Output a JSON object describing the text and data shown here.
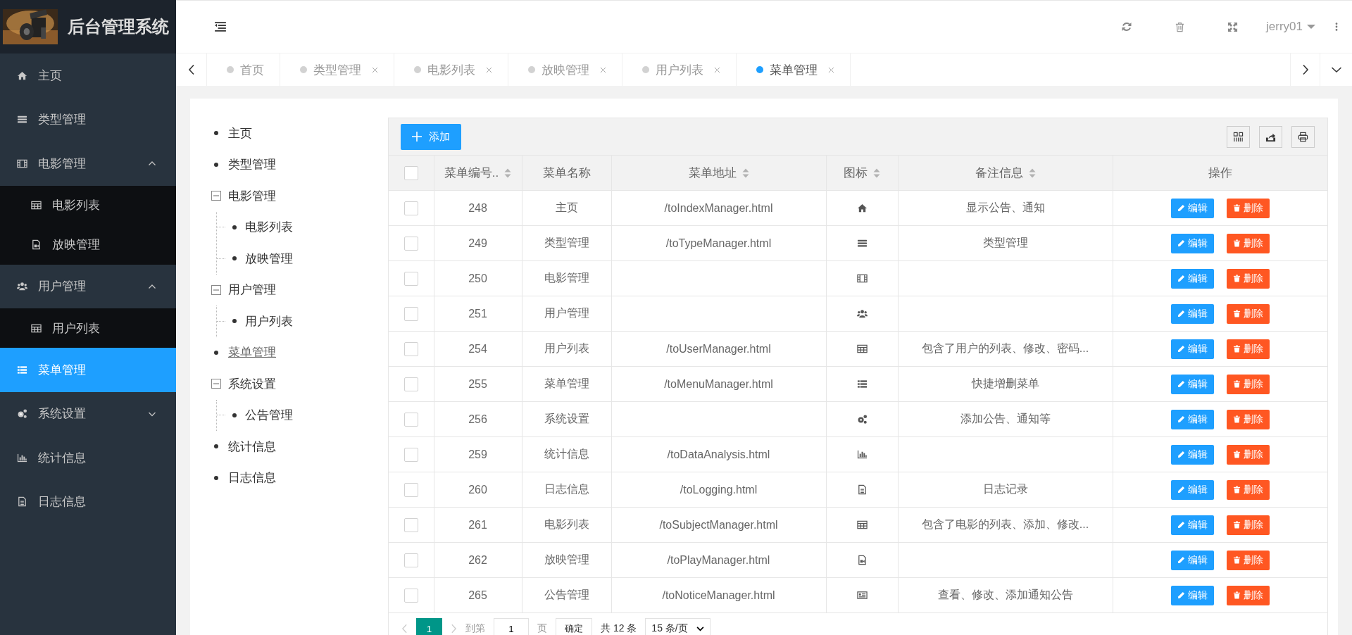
{
  "app": {
    "title": "后台管理系统"
  },
  "sidebar": {
    "items": [
      {
        "label": "主页",
        "selected": false
      },
      {
        "label": "类型管理",
        "selected": false
      },
      {
        "label": "电影管理",
        "selected": false,
        "expanded": true,
        "children": [
          {
            "label": "电影列表",
            "selected": false
          },
          {
            "label": "放映管理",
            "selected": false
          }
        ]
      },
      {
        "label": "用户管理",
        "selected": false,
        "expanded": true,
        "children": [
          {
            "label": "用户列表",
            "selected": false
          }
        ]
      },
      {
        "label": "菜单管理",
        "selected": true
      },
      {
        "label": "系统设置",
        "selected": false,
        "expanded": false
      },
      {
        "label": "统计信息",
        "selected": false
      },
      {
        "label": "日志信息",
        "selected": false
      }
    ]
  },
  "header": {
    "user": "jerry01"
  },
  "tabs": [
    {
      "label": "首页",
      "selected": false,
      "closable": false
    },
    {
      "label": "类型管理",
      "selected": false,
      "closable": true
    },
    {
      "label": "电影列表",
      "selected": false,
      "closable": true
    },
    {
      "label": "放映管理",
      "selected": false,
      "closable": true
    },
    {
      "label": "用户列表",
      "selected": false,
      "closable": true
    },
    {
      "label": "菜单管理",
      "selected": true,
      "closable": true
    }
  ],
  "tree": [
    {
      "label": "主页",
      "selected": false
    },
    {
      "label": "类型管理",
      "selected": false
    },
    {
      "label": "电影管理",
      "selected": false,
      "expanded": true,
      "children": [
        {
          "label": "电影列表",
          "selected": false
        },
        {
          "label": "放映管理",
          "selected": false
        }
      ]
    },
    {
      "label": "用户管理",
      "selected": false,
      "expanded": true,
      "children": [
        {
          "label": "用户列表",
          "selected": false
        }
      ]
    },
    {
      "label": "菜单管理",
      "selected": true
    },
    {
      "label": "系统设置",
      "selected": false,
      "expanded": true,
      "children": [
        {
          "label": "公告管理",
          "selected": false
        }
      ]
    },
    {
      "label": "统计信息",
      "selected": false
    },
    {
      "label": "日志信息",
      "selected": false
    }
  ],
  "table": {
    "add_button": "添加",
    "columns": [
      {
        "label": "菜单编号..",
        "sortable": true
      },
      {
        "label": "菜单名称",
        "sortable": false
      },
      {
        "label": "菜单地址",
        "sortable": true
      },
      {
        "label": "图标",
        "sortable": true
      },
      {
        "label": "备注信息",
        "sortable": true
      },
      {
        "label": "操作",
        "sortable": false
      }
    ],
    "all_checked": false,
    "rows": [
      {
        "id": "248",
        "name": "主页",
        "url": "/toIndexManager.html",
        "remark": "显示公告、通知",
        "checked": false,
        "actions": [
          "编辑",
          "删除"
        ]
      },
      {
        "id": "249",
        "name": "类型管理",
        "url": "/toTypeManager.html",
        "remark": "类型管理",
        "checked": false,
        "actions": [
          "编辑",
          "删除"
        ]
      },
      {
        "id": "250",
        "name": "电影管理",
        "url": "",
        "remark": "",
        "checked": false,
        "actions": [
          "编辑",
          "删除"
        ]
      },
      {
        "id": "251",
        "name": "用户管理",
        "url": "",
        "remark": "",
        "checked": false,
        "actions": [
          "编辑",
          "删除"
        ]
      },
      {
        "id": "254",
        "name": "用户列表",
        "url": "/toUserManager.html",
        "remark": "包含了用户的列表、修改、密码...",
        "checked": false,
        "actions": [
          "编辑",
          "删除"
        ]
      },
      {
        "id": "255",
        "name": "菜单管理",
        "url": "/toMenuManager.html",
        "remark": "快捷增删菜单",
        "checked": false,
        "actions": [
          "编辑",
          "删除"
        ]
      },
      {
        "id": "256",
        "name": "系统设置",
        "url": "",
        "remark": "添加公告、通知等",
        "checked": false,
        "actions": [
          "编辑",
          "删除"
        ]
      },
      {
        "id": "259",
        "name": "统计信息",
        "url": "/toDataAnalysis.html",
        "remark": "",
        "checked": false,
        "actions": [
          "编辑",
          "删除"
        ]
      },
      {
        "id": "260",
        "name": "日志信息",
        "url": "/toLogging.html",
        "remark": "日志记录",
        "checked": false,
        "actions": [
          "编辑",
          "删除"
        ]
      },
      {
        "id": "261",
        "name": "电影列表",
        "url": "/toSubjectManager.html",
        "remark": "包含了电影的列表、添加、修改...",
        "checked": false,
        "actions": [
          "编辑",
          "删除"
        ]
      },
      {
        "id": "262",
        "name": "放映管理",
        "url": "/toPlayManager.html",
        "remark": "",
        "checked": false,
        "actions": [
          "编辑",
          "删除"
        ]
      },
      {
        "id": "265",
        "name": "公告管理",
        "url": "/toNoticeManager.html",
        "remark": "查看、修改、添加通知公告",
        "checked": false,
        "actions": [
          "编辑",
          "删除"
        ]
      }
    ],
    "pagination": {
      "pages": [
        {
          "label": "1",
          "selected": true
        }
      ],
      "goto_label": "到第",
      "goto_value": "1",
      "page_unit": "页",
      "confirm": "确定",
      "total": "共 12 条",
      "page_size": "15 条/页"
    }
  }
}
